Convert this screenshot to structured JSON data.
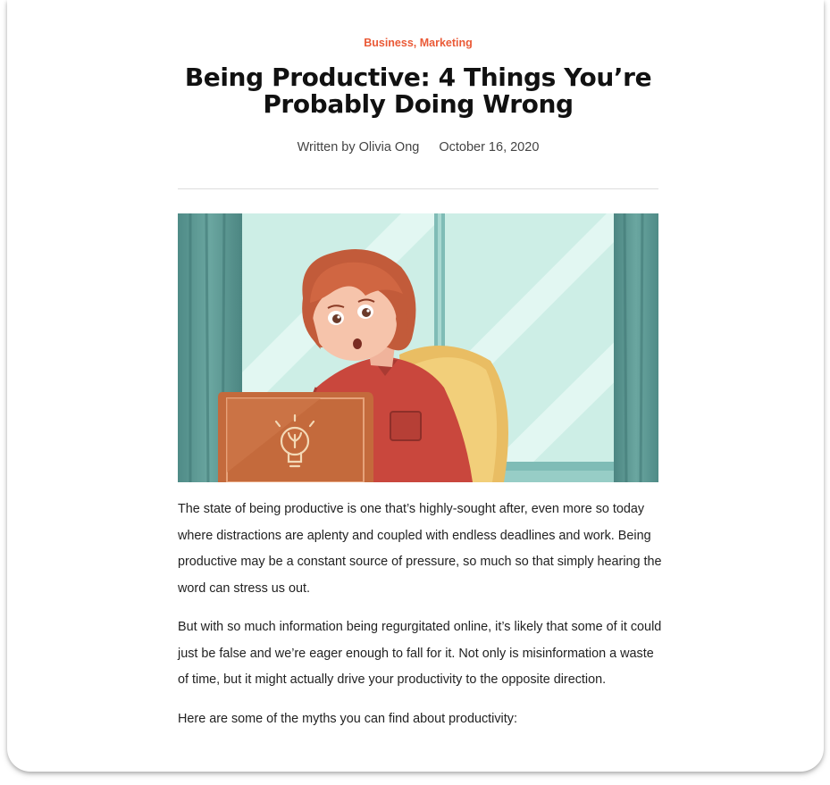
{
  "article": {
    "categories": [
      "Business",
      "Marketing"
    ],
    "category_separator": ", ",
    "title_lines": [
      "Being Productive: 4 Things You’re",
      "Probably Doing Wrong"
    ],
    "byline": "Written by Olivia Ong",
    "date": "October 16, 2020",
    "paragraphs": [
      "The state of being productive is one that’s highly-sought after, even more so today where distractions are aplenty and coupled with endless deadlines and work. Being productive may be a constant source of pressure, so much so that simply hearing the word can stress us out.",
      "But with so much information being regurgitated online, it’s likely that some of it could just be false and we’re eager enough to fall for it. Not only is misinformation a waste of time, but it might actually drive your productivity to the opposite direction.",
      "Here are some of the myths you can find about productivity:"
    ]
  },
  "hero_image": {
    "subject": "illustration of a surprised woman with red hair using a laptop in front of a window",
    "icons": [
      "lightbulb-icon"
    ]
  },
  "colors": {
    "accent": "#ea5a37",
    "title": "#111111",
    "text": "#222222",
    "meta": "#444444",
    "divider": "#dcdcdc"
  }
}
